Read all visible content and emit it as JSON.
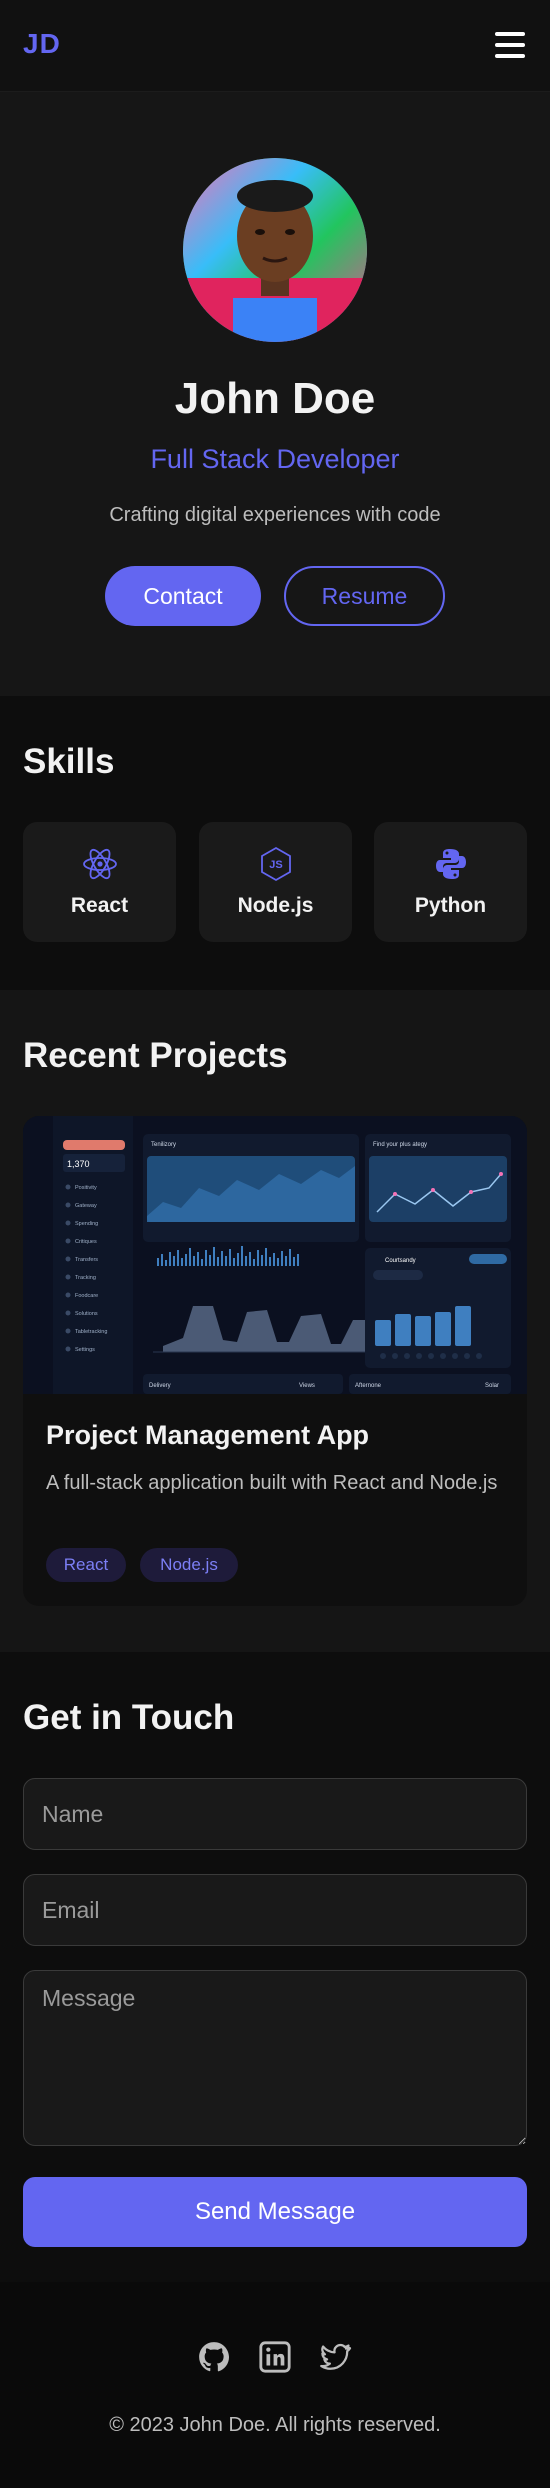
{
  "header": {
    "logo": "JD",
    "menu_icon": "hamburger-menu-icon"
  },
  "hero": {
    "name": "John Doe",
    "role": "Full Stack Developer",
    "tagline": "Crafting digital experiences with code",
    "contact_label": "Contact",
    "resume_label": "Resume",
    "accent": "#6366f1"
  },
  "skills": {
    "title": "Skills",
    "items": [
      {
        "label": "React",
        "icon": "react-icon"
      },
      {
        "label": "Node.js",
        "icon": "nodejs-icon"
      },
      {
        "label": "Python",
        "icon": "python-icon"
      }
    ]
  },
  "projects": {
    "title": "Recent Projects",
    "items": [
      {
        "title": "Project Management App",
        "description": "A full-stack application built with React and Node.js",
        "tags": [
          "React",
          "Node.js"
        ]
      }
    ],
    "screenshot": {
      "sidebar_value": "1,370",
      "sidebar_items": [
        "Positivity",
        "Gateway",
        "Spending",
        "Critiques",
        "Transfers",
        "Tracking",
        "Foodcare",
        "Solutions",
        "Tabletracking",
        "Settings"
      ],
      "card1_title": "Tenilizory",
      "card2_title": "Find your plus ategy",
      "card3_title": "Courtsandy",
      "bottom_left": "Delivery",
      "bottom_left_right": "Views",
      "bottom_right": "Afternone",
      "bottom_right_right": "Solar"
    }
  },
  "contact": {
    "title": "Get in Touch",
    "name_placeholder": "Name",
    "email_placeholder": "Email",
    "message_placeholder": "Message",
    "send_label": "Send Message"
  },
  "footer": {
    "social": [
      "github-icon",
      "linkedin-icon",
      "twitter-icon"
    ],
    "copyright": "© 2023 John Doe. All rights reserved."
  }
}
